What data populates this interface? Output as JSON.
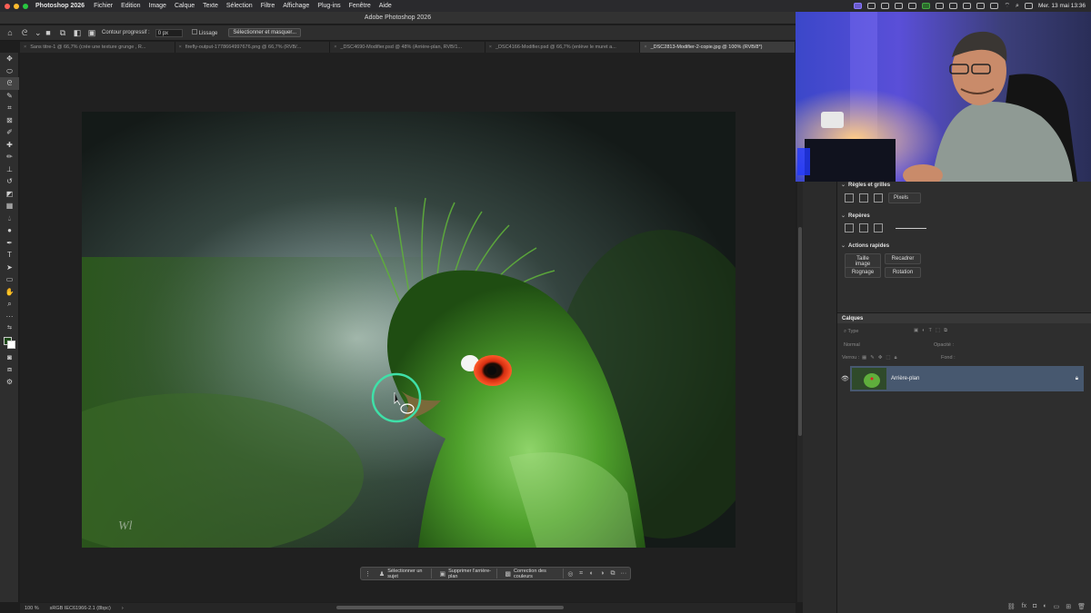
{
  "menubar": {
    "app": "Photoshop 2026",
    "items": [
      "Fichier",
      "Edition",
      "Image",
      "Calque",
      "Texte",
      "Sélection",
      "Filtre",
      "Affichage",
      "Plug-ins",
      "Fenêtre",
      "Aide"
    ],
    "datetime": "Mer. 13 mai 13:36"
  },
  "window": {
    "title": "Adobe Photoshop 2026"
  },
  "options": {
    "contour_label": "Contour progressif :",
    "contour_value": "0 px",
    "lissage_label": "Lissage",
    "select_mask": "Sélectionner et masquer..."
  },
  "tabs": [
    "Sans titre-1 @ 66,7% (crée une texture grunge   , R...",
    "firefly-output-1778664997676.png @ 66,7% (RVB/...",
    "_DSC4690-Modifier.psd @ 48% (Arrière-plan, RVB/1...",
    "_DSC4166-Modifier.psd @ 66,7% (enlève le muret a...",
    "_DSC2813-Modifier-2-copie.jpg @ 100% (RVB/8*)"
  ],
  "contextbar": {
    "select_subject": "Sélectionner un sujet",
    "remove_bg": "Supprimer l'arrière-plan",
    "color_correction": "Correction des couleurs"
  },
  "statusbar": {
    "zoom": "100 %",
    "profile": "sRGB IEC61966-2.1 (8bpc)",
    "arrow": "›"
  },
  "panels": {
    "rules": {
      "title": "Règles et grilles",
      "unit": "Pixels"
    },
    "guides": {
      "title": "Repères"
    },
    "quick": {
      "title": "Actions rapides",
      "buttons": [
        "Taille image",
        "Recadrer",
        "Rognage",
        "Rotation"
      ]
    },
    "layers": {
      "title": "Calques",
      "filter_placeholder": "Type",
      "blend": "Normal",
      "opacity_label": "Opacité :",
      "lock_label": "Verrou :",
      "fill_label": "Fond :",
      "layer_name": "Arrière-plan"
    }
  },
  "colors": {
    "accent_ring": "#3fe0a8",
    "layer_selected": "#47586f"
  }
}
